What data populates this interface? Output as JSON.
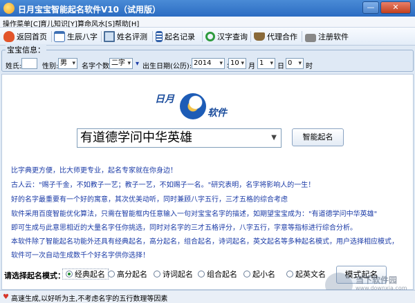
{
  "window": {
    "title": "日月宝宝智能起名软件V10（试用版）",
    "min_label": "—",
    "close_label": "✕"
  },
  "menu": [
    "操作菜单[C]",
    "育儿知识[Y]",
    "算命风水[S]",
    "帮助[H]"
  ],
  "toolbar": [
    {
      "label": "返回首页",
      "icon": "heart-icon",
      "color": "#e2552b"
    },
    {
      "label": "生辰八字",
      "icon": "calendar-icon",
      "color": "#3d6fb4"
    },
    {
      "label": "姓名评测",
      "icon": "monitor-icon",
      "color": "#4a6f9a"
    },
    {
      "label": "起名记录",
      "icon": "record-icon",
      "color": "#2f5fa8"
    },
    {
      "label": "汉字查询",
      "icon": "search-icon",
      "color": "#2e9a3e"
    },
    {
      "label": "代理合作",
      "icon": "coffee-icon",
      "color": "#8a6a3a"
    },
    {
      "label": "注册软件",
      "icon": "lock-icon",
      "color": "#666666"
    }
  ],
  "baby": {
    "panel_title": "宝宝信息：",
    "surname_label": "姓氏:",
    "surname_value": "",
    "gender_label": "性别:",
    "gender_value": "男",
    "name_count_label": "名字个数:",
    "name_count_value": "二字",
    "birth_label": "出生日期(公历):",
    "year": "2014",
    "year_unit": "年",
    "month": "10",
    "month_unit": "月",
    "day": "1",
    "day_unit": "日",
    "hour": "0",
    "hour_unit": "时"
  },
  "logo": {
    "text1": "日月",
    "text2": "软件"
  },
  "search": {
    "value": "有道德学问中华英雄",
    "button": "智能起名"
  },
  "info_lines": [
    "比字典更方便，比大师更专业，起名专家就在你身边！",
    "古人云：\"赐子千金，不如教子一艺；教子一艺，不如赐子一名。\"研究表明，名字将影响人的一生！",
    "好的名字最重要有一个好的寓意，其次优美动听，同时兼顾八字五行，三才五格的综合考虑",
    "软件采用百度智能优化算法，只需在智能框内任意输入一句对宝宝名字的描述，如期望宝宝成为：\"有道德学问中华英雄\"",
    "即可生成与此意思相近的大量名字任你挑选，同时对名字的三才五格评分，八字五行，字意等指标进行综合分析。",
    "本软件除了智能起名功能外还具有经典起名，高分起名，组合起名，诗词起名，英文起名等多种起名模式，用户选择相应模式，",
    "软件可一次自动生成数千个好名字供你选择！"
  ],
  "mode": {
    "label": "请选择起名模式：",
    "options": [
      "经典起名",
      "高分起名",
      "诗词起名",
      "组合起名",
      "起小名",
      "起英文名"
    ],
    "selected": "经典起名",
    "button": "模式起名"
  },
  "status": "高速生成,以好听为主,不考虑名字的五行数理等因素",
  "watermark": {
    "text": "当下软件园",
    "url": "www.downxia.com"
  }
}
